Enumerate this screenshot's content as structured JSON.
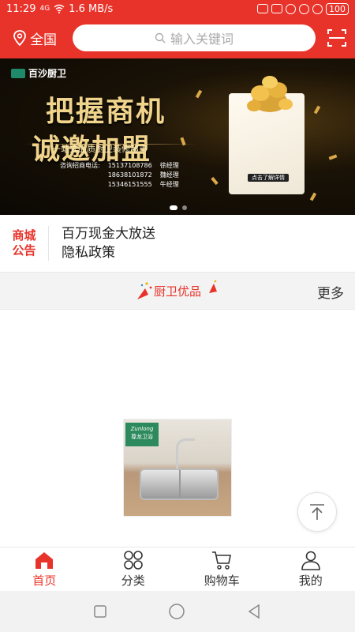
{
  "status_bar": {
    "time": "11:29",
    "network": "4G",
    "speed": "1.6 MB/s",
    "battery": "100"
  },
  "header": {
    "location_label": "全国",
    "search_placeholder": "输入关键词",
    "location_icon": "location-pin-icon",
    "scan_icon": "scan-icon"
  },
  "banner": {
    "brand": "百沙厨卫",
    "headline_line1": "把握商机",
    "headline_line2": "诚邀加盟",
    "subtitle": "一站式品质厨卫装修超市",
    "contacts_label": "咨询招商电话:",
    "phones": [
      "15137108786",
      "18638101872",
      "15346151555"
    ],
    "managers": [
      "徐经理",
      "魏经理",
      "牛经理"
    ],
    "box_label": "点击了解详情",
    "slide_count": 2,
    "active_slide": 1
  },
  "notice": {
    "tag_line1": "商城",
    "tag_line2": "公告",
    "items": [
      "百万现金大放送",
      "隐私政策"
    ]
  },
  "section": {
    "title": "厨卫优品",
    "more_label": "更多"
  },
  "product": {
    "badge_text": "尊龙卫浴",
    "badge_brand": "Zunlong"
  },
  "tabbar": {
    "items": [
      {
        "label": "首页",
        "icon": "home-icon",
        "active": true
      },
      {
        "label": "分类",
        "icon": "category-icon",
        "active": false
      },
      {
        "label": "购物车",
        "icon": "cart-icon",
        "active": false
      },
      {
        "label": "我的",
        "icon": "user-icon",
        "active": false
      }
    ]
  },
  "colors": {
    "accent": "#e8332a",
    "section_bg": "#f3f3f3"
  }
}
